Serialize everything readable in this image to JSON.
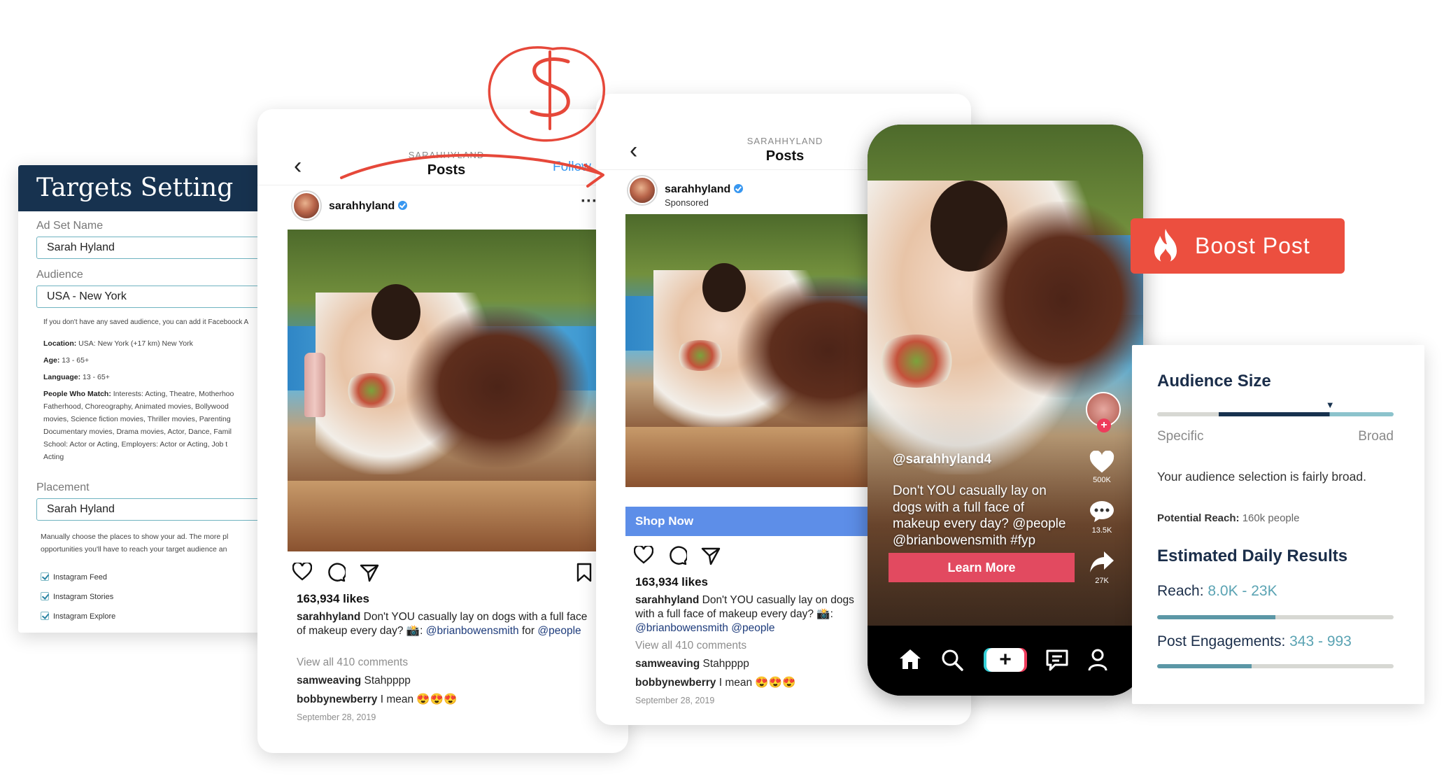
{
  "colors": {
    "navy": "#17324f",
    "accent_teal": "#5aa3b3",
    "boost_red": "#ec4f3f",
    "shop_blue": "#5d8ee8",
    "learn_more": "#e24a60",
    "annotation_red": "#e6483a"
  },
  "targets": {
    "title": "Targets Setting",
    "ad_set_name_label": "Ad Set Name",
    "ad_set_name_value": "Sarah Hyland",
    "audience_label": "Audience",
    "audience_value": "USA - New York",
    "audience_hint": "If you don't have any saved audience, you can add it Faceboock A",
    "location_label": "Location:",
    "location_value": "USA: New York (+17 km) New York",
    "age_label": "Age:",
    "age_value": "13 - 65+",
    "language_label": "Language:",
    "language_value": "13 - 65+",
    "people_label": "People Who Match:",
    "people_lines": [
      "Interests: Acting, Theatre, Motherhoo",
      "Fatherhood, Choreography, Animated movies, Bollywood",
      "movies, Science fiction movies, Thriller movies, Parenting",
      "Documentary movies, Drama movies, Actor, Dance, Famil",
      "School: Actor or Acting, Employers: Actor or Acting, Job t",
      "Acting"
    ],
    "placement_label": "Placement",
    "placement_value": "Sarah Hyland",
    "placement_hint_1": "Manually choose the places to show your ad. The more pl",
    "placement_hint_2": "opportunities you'll have to reach your target audience an",
    "checkboxes": [
      "Instagram Feed",
      "Instagram Stories",
      "Instagram Explore"
    ]
  },
  "ig_left": {
    "nav_sub": "SARAHHYLAND",
    "nav_title": "Posts",
    "follow": "Follow",
    "username": "sarahhyland",
    "more_icon": "more-dots-icon",
    "likes": "163,934 likes",
    "caption_user": "sarahhyland",
    "caption_text": "Don't YOU casually lay on dogs with a full face of makeup every day? 📸:",
    "caption_link1": "@brianbowensmith",
    "caption_for": "for",
    "caption_link2": "@people",
    "view_comments": "View all 410 comments",
    "comment1_user": "samweaving",
    "comment1_text": "Stahpppp",
    "comment2_user": "bobbynewberry",
    "comment2_text": "I mean 😍😍😍",
    "date": "September 28, 2019"
  },
  "ig_mid": {
    "nav_sub": "SARAHHYLAND",
    "nav_title": "Posts",
    "username": "sarahhyland",
    "sponsored": "Sponsored",
    "shop_now": "Shop Now",
    "likes": "163,934 likes",
    "caption_user": "sarahhyland",
    "caption_text": "Don't YOU casually lay on dogs with a full face of makeup every day? 📸:",
    "caption_link1": "@brianbowensmith",
    "caption_link2": "@people",
    "view_comments": "View all 410 comments",
    "comment1_user": "samweaving",
    "comment1_text": "Stahpppp",
    "comment2_user": "bobbynewberry",
    "comment2_text": "I mean 😍😍😍",
    "date": "September 28, 2019"
  },
  "tiktok": {
    "username": "@sarahhyland4",
    "caption": "Don't YOU casually lay on dogs with a full face of makeup every day? @people @brianbowensmith #fyp",
    "learn_more": "Learn More",
    "likes_count": "500K",
    "comments_count": "13.5K",
    "shares_count": "27K"
  },
  "boost": {
    "label": "Boost Post"
  },
  "audience": {
    "title": "Audience Size",
    "specific": "Specific",
    "broad": "Broad",
    "description": "Your audience selection is fairly broad.",
    "potential_reach_label": "Potential Reach:",
    "potential_reach_value": "160k people",
    "daily_title": "Estimated Daily Results",
    "reach_label": "Reach:",
    "reach_value": "8.0K - 23K",
    "reach_level": 0.5,
    "engagement_label": "Post Engagements:",
    "engagement_value": "343 - 993",
    "engagement_level": 0.4,
    "gauge_marker_position": 0.73
  }
}
